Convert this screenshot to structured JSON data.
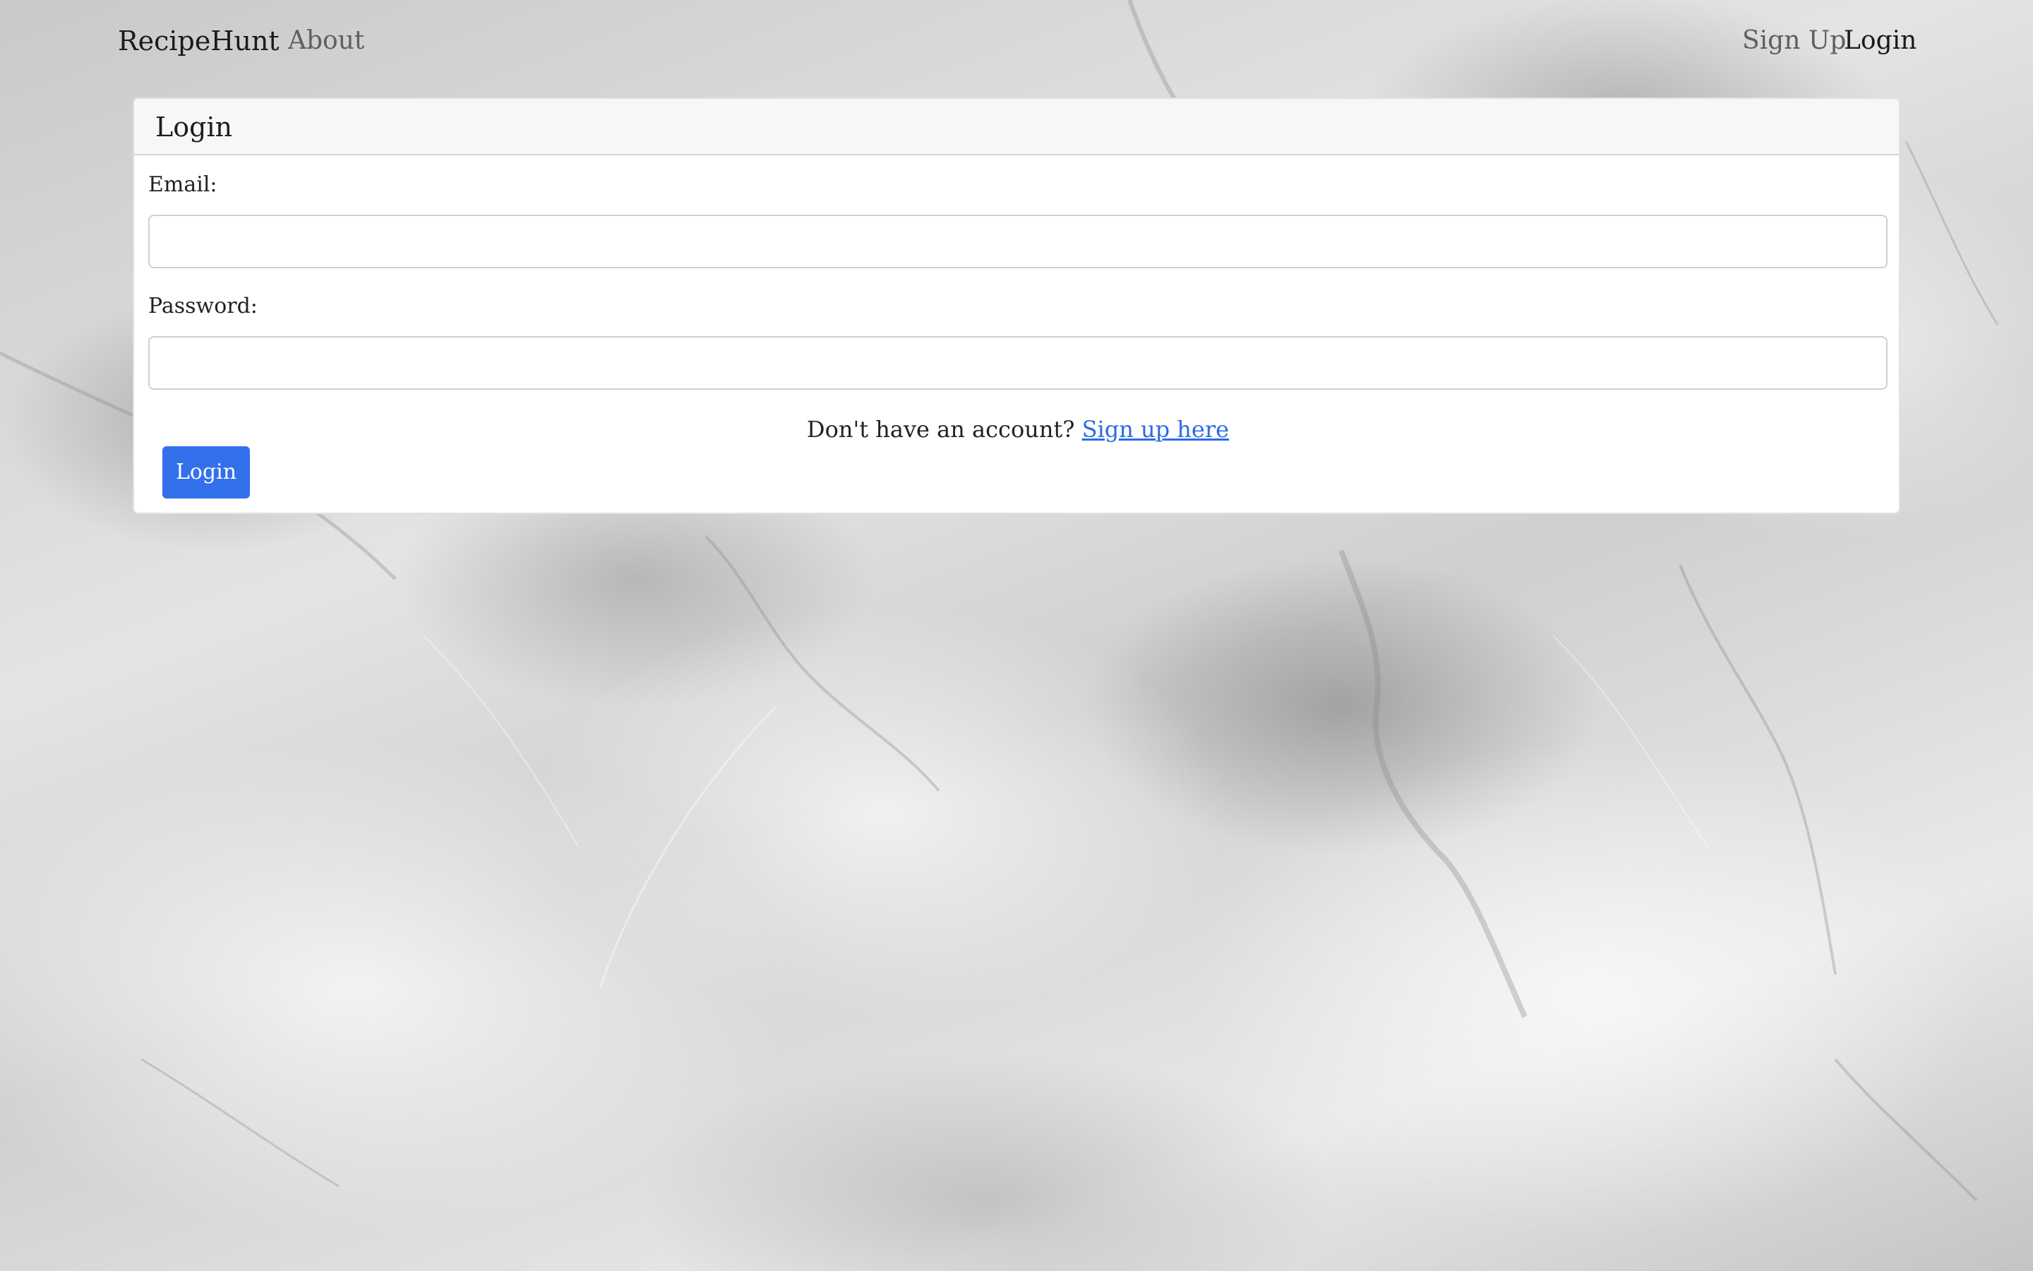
{
  "navbar": {
    "brand": "RecipeHunt",
    "about": "About",
    "sign_up": "Sign Up",
    "login": "Login"
  },
  "card": {
    "title": "Login",
    "email_label": "Email:",
    "email_value": "",
    "password_label": "Password:",
    "password_value": "",
    "no_account_text": "Don't have an account?",
    "signup_link": "Sign up here",
    "login_button": "Login"
  },
  "colors": {
    "primary": "#3370eb",
    "link": "#2e6ae6",
    "card_header_bg": "#f7f7f7"
  }
}
